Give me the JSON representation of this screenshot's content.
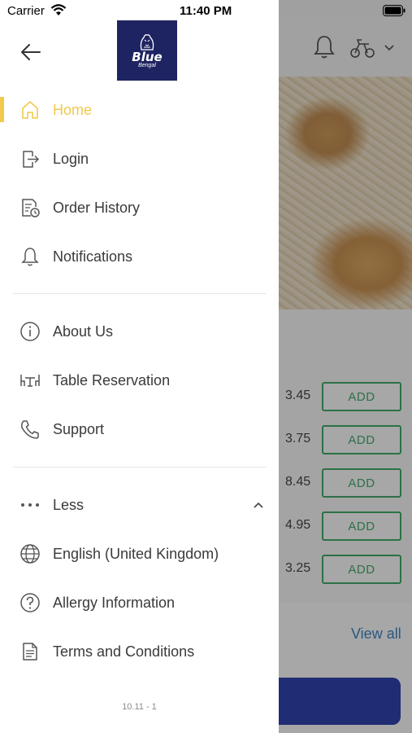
{
  "status_bar": {
    "carrier": "Carrier",
    "time": "11:40 PM"
  },
  "brand": {
    "logo_main": "Blue",
    "logo_sub": "Bengal",
    "logo_color": "#1e2462"
  },
  "drawer": {
    "accent_color": "#f2c94c",
    "items": [
      {
        "label": "Home",
        "icon": "home-icon",
        "active": true
      },
      {
        "label": "Login",
        "icon": "login-icon"
      },
      {
        "label": "Order History",
        "icon": "order-history-icon"
      },
      {
        "label": "Notifications",
        "icon": "bell-icon"
      },
      {
        "label": "About Us",
        "icon": "info-icon"
      },
      {
        "label": "Table Reservation",
        "icon": "table-icon"
      },
      {
        "label": "Support",
        "icon": "phone-icon"
      },
      {
        "label": "Less",
        "icon": "more-dots-icon"
      },
      {
        "label": "English (United Kingdom)",
        "icon": "globe-icon"
      },
      {
        "label": "Allergy Information",
        "icon": "question-icon"
      },
      {
        "label": "Terms and Conditions",
        "icon": "document-icon"
      }
    ],
    "version": "10.11 - 1"
  },
  "background": {
    "prices": [
      "3.45",
      "3.75",
      "8.45",
      "4.95",
      "3.25"
    ],
    "add_label": "ADD",
    "view_all": "View all",
    "add_color": "#1f9d4f",
    "primary_button_color": "#0a1fa0"
  }
}
